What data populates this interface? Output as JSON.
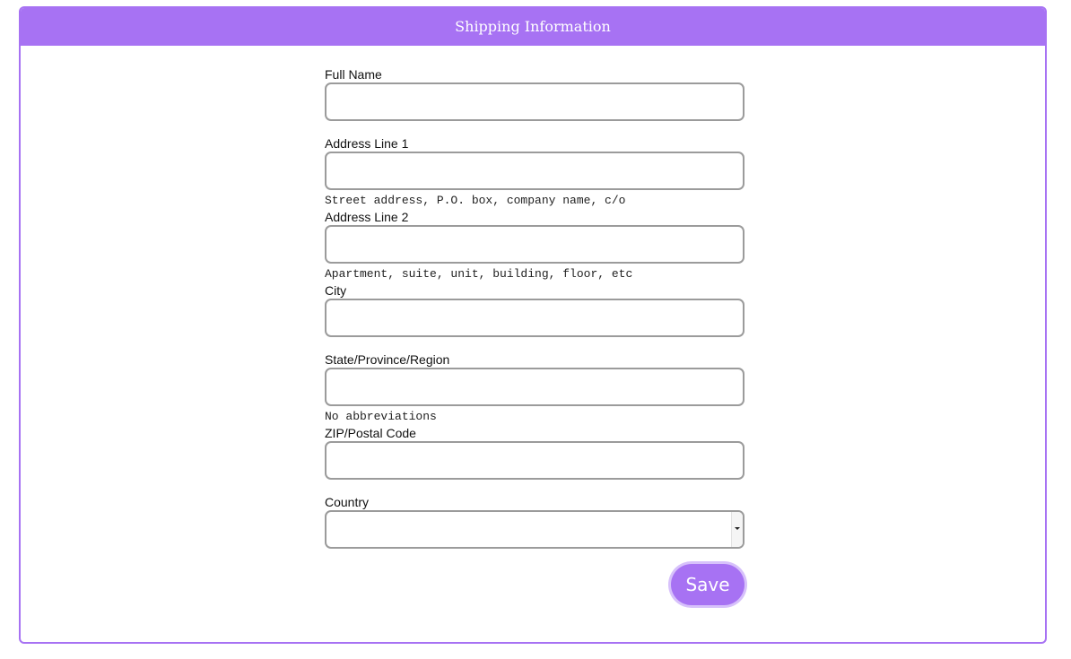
{
  "header": {
    "title": "Shipping Information"
  },
  "form": {
    "full_name": {
      "label": "Full Name",
      "value": ""
    },
    "address_line_1": {
      "label": "Address Line 1",
      "value": "",
      "hint": "Street address, P.O. box, company name, c/o"
    },
    "address_line_2": {
      "label": "Address Line 2",
      "value": "",
      "hint": "Apartment, suite, unit, building, floor, etc"
    },
    "city": {
      "label": "City",
      "value": ""
    },
    "state": {
      "label": "State/Province/Region",
      "value": "",
      "hint": "No abbreviations"
    },
    "zip": {
      "label": "ZIP/Postal Code",
      "value": ""
    },
    "country": {
      "label": "Country",
      "value": ""
    }
  },
  "actions": {
    "save_label": "Save"
  },
  "colors": {
    "accent": "#a772f3",
    "input_border": "#9b9b9b"
  },
  "icons": {
    "country_dropdown": "chevron-down-icon"
  }
}
